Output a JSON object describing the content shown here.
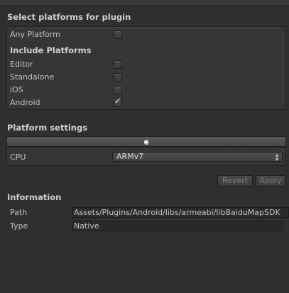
{
  "platforms_header": {
    "title": "Select platforms for plugin"
  },
  "any_platform": {
    "label": "Any Platform",
    "checked": false
  },
  "include_header": {
    "title": "Include Platforms"
  },
  "include_platforms": [
    {
      "label": "Editor",
      "checked": false
    },
    {
      "label": "Standalone",
      "checked": false
    },
    {
      "label": "iOS",
      "checked": false
    },
    {
      "label": "Android",
      "checked": true
    }
  ],
  "platform_settings": {
    "title": "Platform settings",
    "tab_icon": "android-icon",
    "cpu_label": "CPU",
    "cpu_value": "ARMv7"
  },
  "buttons": {
    "revert": "Revert",
    "apply": "Apply"
  },
  "information": {
    "title": "Information",
    "path_label": "Path",
    "path_value": "Assets/Plugins/Android/libs/armeabi/libBaiduMapSDK",
    "type_label": "Type",
    "type_value": "Native"
  },
  "icons": {
    "dropdown": "up-down-arrows-icon",
    "check": "checkmark-icon"
  },
  "colors": {
    "background": "#2f2f2f",
    "panel": "#363636",
    "text": "#c8c8c8"
  }
}
